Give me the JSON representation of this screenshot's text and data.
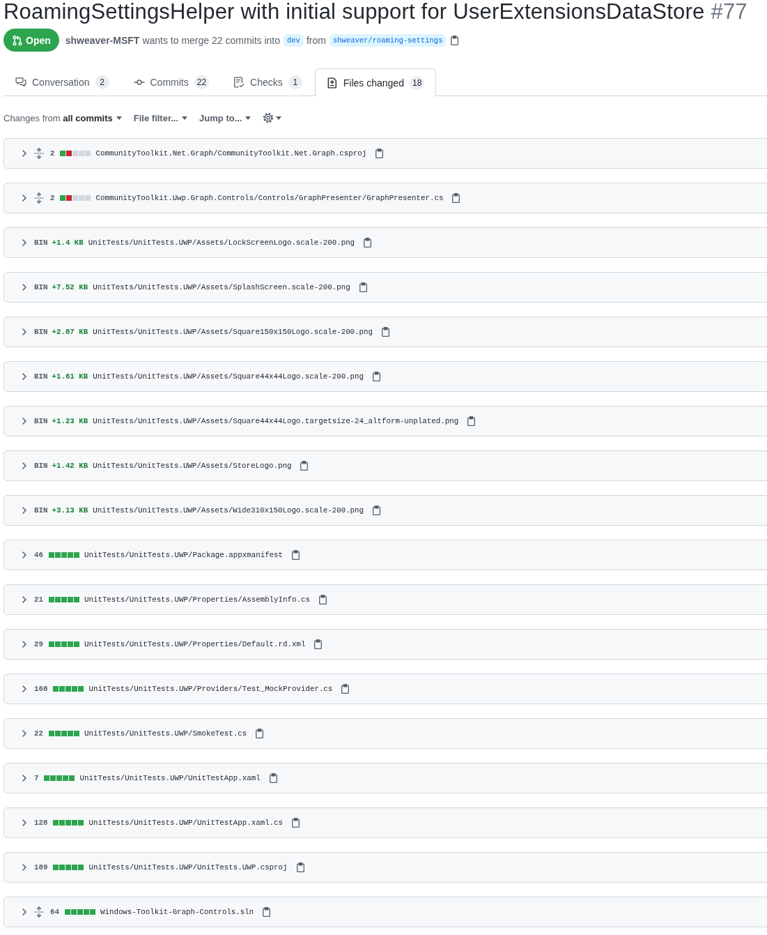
{
  "title": "RoamingSettingsHelper with initial support for UserExtensionsDataStore",
  "number": "#77",
  "pr": {
    "state": "Open",
    "author": "shweaver-MSFT",
    "merge_text": "wants to merge 22 commits into",
    "base_branch": "dev",
    "from_text": "from",
    "head_branch": "shweaver/roaming-settings"
  },
  "tabs": [
    {
      "kind": "conversation",
      "label": "Conversation",
      "count": "2",
      "selected": false
    },
    {
      "kind": "commits",
      "label": "Commits",
      "count": "22",
      "selected": false
    },
    {
      "kind": "checks",
      "label": "Checks",
      "count": "1",
      "selected": false
    },
    {
      "kind": "files",
      "label": "Files changed",
      "count": "18",
      "selected": true
    }
  ],
  "toolbar": [
    {
      "kind": "compare",
      "label": "Changes from **all commits**"
    },
    {
      "kind": "dropdown",
      "label": "File filter..."
    },
    {
      "kind": "dropdown",
      "label": "Jump to..."
    },
    {
      "kind": "settings"
    }
  ],
  "files": [
    {
      "kind": "text",
      "expanded": false,
      "expandable": true,
      "changes": "2",
      "diffstat": [
        {
          "color": "#2da44e"
        },
        {
          "color": "#cf222e"
        },
        {
          "color": "#d0d7de"
        },
        {
          "color": "#d0d7de"
        },
        {
          "color": "#d0d7de"
        }
      ],
      "path": "CommunityToolkit.Net.Graph/CommunityToolkit.Net.Graph.csproj"
    },
    {
      "kind": "text",
      "expanded": false,
      "expandable": true,
      "changes": "2",
      "diffstat": [
        {
          "color": "#2da44e"
        },
        {
          "color": "#cf222e"
        },
        {
          "color": "#d0d7de"
        },
        {
          "color": "#d0d7de"
        },
        {
          "color": "#d0d7de"
        }
      ],
      "path": "CommunityToolkit.Uwp.Graph.Controls/Controls/GraphPresenter/GraphPresenter.cs"
    },
    {
      "kind": "binary",
      "expanded": false,
      "type_label": "BIN",
      "size": "+1.4 KB",
      "path": "UnitTests/UnitTests.UWP/Assets/LockScreenLogo.scale-200.png"
    },
    {
      "kind": "binary",
      "expanded": false,
      "type_label": "BIN",
      "size": "+7.52 KB",
      "path": "UnitTests/UnitTests.UWP/Assets/SplashScreen.scale-200.png"
    },
    {
      "kind": "binary",
      "expanded": false,
      "type_label": "BIN",
      "size": "+2.87 KB",
      "path": "UnitTests/UnitTests.UWP/Assets/Square150x150Logo.scale-200.png"
    },
    {
      "kind": "binary",
      "expanded": false,
      "type_label": "BIN",
      "size": "+1.61 KB",
      "path": "UnitTests/UnitTests.UWP/Assets/Square44x44Logo.scale-200.png"
    },
    {
      "kind": "binary",
      "expanded": false,
      "type_label": "BIN",
      "size": "+1.23 KB",
      "path": "UnitTests/UnitTests.UWP/Assets/Square44x44Logo.targetsize-24_altform-unplated.png"
    },
    {
      "kind": "binary",
      "expanded": false,
      "type_label": "BIN",
      "size": "+1.42 KB",
      "path": "UnitTests/UnitTests.UWP/Assets/StoreLogo.png"
    },
    {
      "kind": "binary",
      "expanded": false,
      "type_label": "BIN",
      "size": "+3.13 KB",
      "path": "UnitTests/UnitTests.UWP/Assets/Wide310x150Logo.scale-200.png"
    },
    {
      "kind": "text",
      "expanded": false,
      "expandable": false,
      "changes": "46",
      "diffstat": [
        {
          "color": "#2da44e"
        },
        {
          "color": "#2da44e"
        },
        {
          "color": "#2da44e"
        },
        {
          "color": "#2da44e"
        },
        {
          "color": "#2da44e"
        }
      ],
      "path": "UnitTests/UnitTests.UWP/Package.appxmanifest"
    },
    {
      "kind": "text",
      "expanded": false,
      "expandable": false,
      "changes": "21",
      "diffstat": [
        {
          "color": "#2da44e"
        },
        {
          "color": "#2da44e"
        },
        {
          "color": "#2da44e"
        },
        {
          "color": "#2da44e"
        },
        {
          "color": "#2da44e"
        }
      ],
      "path": "UnitTests/UnitTests.UWP/Properties/AssemblyInfo.cs"
    },
    {
      "kind": "text",
      "expanded": false,
      "expandable": false,
      "changes": "29",
      "diffstat": [
        {
          "color": "#2da44e"
        },
        {
          "color": "#2da44e"
        },
        {
          "color": "#2da44e"
        },
        {
          "color": "#2da44e"
        },
        {
          "color": "#2da44e"
        }
      ],
      "path": "UnitTests/UnitTests.UWP/Properties/Default.rd.xml"
    },
    {
      "kind": "text",
      "expanded": false,
      "expandable": false,
      "changes": "168",
      "diffstat": [
        {
          "color": "#2da44e"
        },
        {
          "color": "#2da44e"
        },
        {
          "color": "#2da44e"
        },
        {
          "color": "#2da44e"
        },
        {
          "color": "#2da44e"
        }
      ],
      "path": "UnitTests/UnitTests.UWP/Providers/Test_MockProvider.cs"
    },
    {
      "kind": "text",
      "expanded": false,
      "expandable": false,
      "changes": "22",
      "diffstat": [
        {
          "color": "#2da44e"
        },
        {
          "color": "#2da44e"
        },
        {
          "color": "#2da44e"
        },
        {
          "color": "#2da44e"
        },
        {
          "color": "#2da44e"
        }
      ],
      "path": "UnitTests/UnitTests.UWP/SmokeTest.cs"
    },
    {
      "kind": "text",
      "expanded": false,
      "expandable": false,
      "changes": "7",
      "diffstat": [
        {
          "color": "#2da44e"
        },
        {
          "color": "#2da44e"
        },
        {
          "color": "#2da44e"
        },
        {
          "color": "#2da44e"
        },
        {
          "color": "#2da44e"
        }
      ],
      "path": "UnitTests/UnitTests.UWP/UnitTestApp.xaml"
    },
    {
      "kind": "text",
      "expanded": false,
      "expandable": false,
      "changes": "128",
      "diffstat": [
        {
          "color": "#2da44e"
        },
        {
          "color": "#2da44e"
        },
        {
          "color": "#2da44e"
        },
        {
          "color": "#2da44e"
        },
        {
          "color": "#2da44e"
        }
      ],
      "path": "UnitTests/UnitTests.UWP/UnitTestApp.xaml.cs"
    },
    {
      "kind": "text",
      "expanded": false,
      "expandable": false,
      "changes": "189",
      "diffstat": [
        {
          "color": "#2da44e"
        },
        {
          "color": "#2da44e"
        },
        {
          "color": "#2da44e"
        },
        {
          "color": "#2da44e"
        },
        {
          "color": "#2da44e"
        }
      ],
      "path": "UnitTests/UnitTests.UWP/UnitTests.UWP.csproj"
    },
    {
      "kind": "text",
      "expanded": false,
      "expandable": true,
      "changes": "64",
      "diffstat": [
        {
          "color": "#2da44e"
        },
        {
          "color": "#2da44e"
        },
        {
          "color": "#2da44e"
        },
        {
          "color": "#2da44e"
        },
        {
          "color": "#2da44e"
        }
      ],
      "path": "Windows-Toolkit-Graph-Controls.sln"
    }
  ]
}
